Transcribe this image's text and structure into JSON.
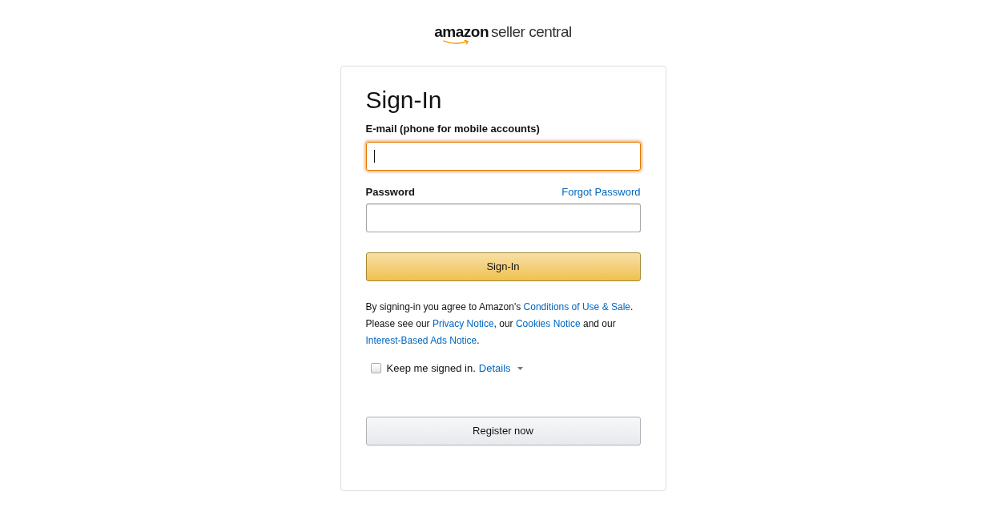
{
  "logo": {
    "brand": "amazon",
    "product": "seller central"
  },
  "title": "Sign-In",
  "email": {
    "label": "E-mail (phone for mobile accounts)",
    "focused": true
  },
  "password": {
    "label": "Password",
    "forgot_link": "Forgot Password",
    "focused": false
  },
  "sign_in_button": "Sign-In",
  "legal": [
    {
      "text": "By signing-in you agree to Amazon's ",
      "link": false
    },
    {
      "text": "Conditions of Use & Sale",
      "link": true
    },
    {
      "text": ". Please see our ",
      "link": false
    },
    {
      "text": "Privacy Notice",
      "link": true
    },
    {
      "text": ", our ",
      "link": false
    },
    {
      "text": "Cookies Notice",
      "link": true
    },
    {
      "text": " and our ",
      "link": false
    },
    {
      "text": "Interest-Based Ads Notice",
      "link": true
    },
    {
      "text": ".",
      "link": false
    }
  ],
  "keep_signed_in": {
    "label": "Keep me signed in.",
    "details": "Details",
    "checked": false
  },
  "register_button": "Register now"
}
